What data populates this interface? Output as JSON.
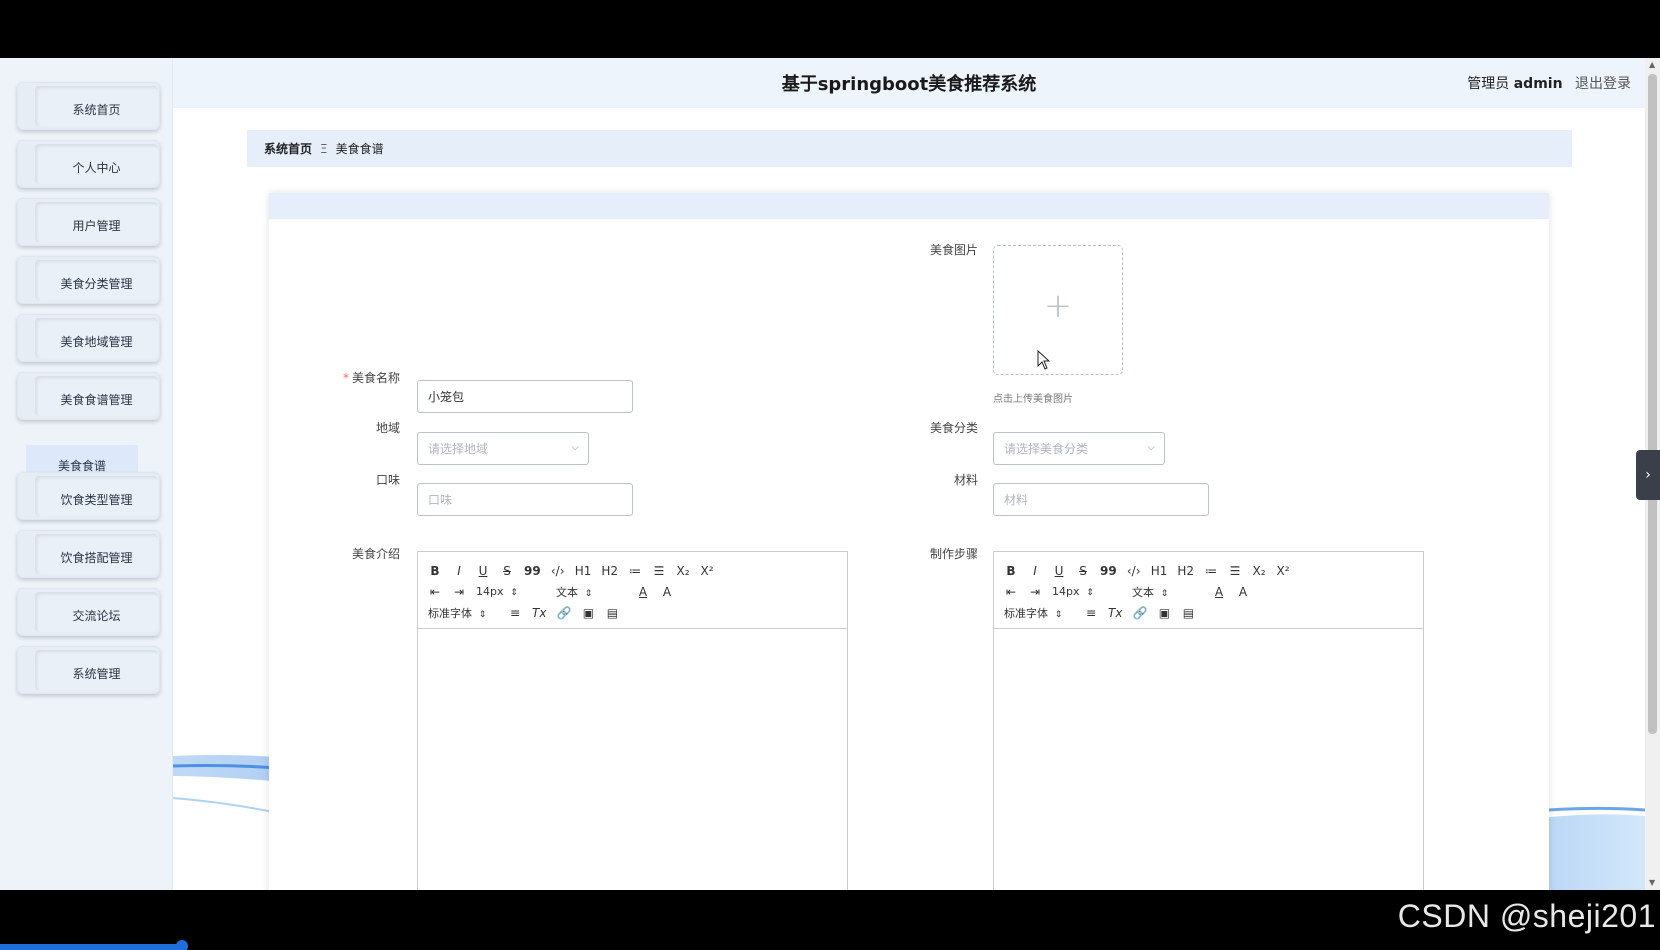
{
  "app": {
    "title": "基于springboot美食推荐系统",
    "admin_role": "管理员",
    "admin_user": "admin",
    "logout": "退出登录"
  },
  "sidebar": {
    "items": [
      {
        "label": "系统首页"
      },
      {
        "label": "个人中心"
      },
      {
        "label": "用户管理"
      },
      {
        "label": "美食分类管理"
      },
      {
        "label": "美食地域管理"
      },
      {
        "label": "美食食谱管理"
      },
      {
        "label": "饮食类型管理"
      },
      {
        "label": "饮食搭配管理"
      },
      {
        "label": "交流论坛"
      },
      {
        "label": "系统管理"
      }
    ],
    "sub_item": "美食食谱"
  },
  "breadcrumb": {
    "home": "系统首页",
    "separator": "Ξ",
    "current": "美食食谱"
  },
  "form": {
    "image_label": "美食图片",
    "upload_tip": "点击上传美食图片",
    "name_label": "美食名称",
    "name_required_mark": "*",
    "name_value": "小笼包",
    "region_label": "地域",
    "region_placeholder": "请选择地域",
    "category_label": "美食分类",
    "category_placeholder": "请选择美食分类",
    "taste_label": "口味",
    "taste_placeholder": "口味",
    "material_label": "材料",
    "material_placeholder": "材料",
    "intro_label": "美食介绍",
    "steps_label": "制作步骤"
  },
  "editor_toolbar": {
    "bold": "B",
    "italic": "I",
    "underline": "U",
    "strike": "S",
    "quote": "99",
    "code": "‹/›",
    "h1": "H1",
    "h2": "H2",
    "ordered_list": "≔",
    "bullet_list": "☰",
    "subscript": "X₂",
    "superscript": "X²",
    "indent_out": "⇤",
    "indent_in": "⇥",
    "size": "14px",
    "block": "文本",
    "font": "标准字体",
    "updown": "⇕",
    "align": "≡",
    "clear": "Tx",
    "link": "🔗",
    "image": "▣",
    "video": "▤",
    "color": "A",
    "bg": "A"
  },
  "watermark": "CSDN @sheji201",
  "colors": {
    "accent": "#1e6fd9",
    "required": "#f56c6c",
    "sidebar_bg": "#eef3fa",
    "header_bg": "#eef4fb"
  }
}
